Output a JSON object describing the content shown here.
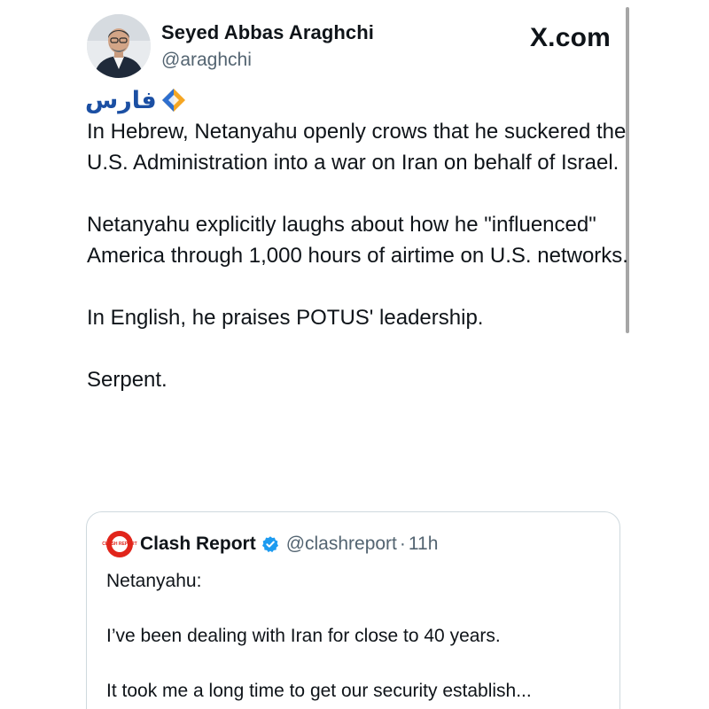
{
  "header": {
    "author_name": "Seyed Abbas Araghchi",
    "author_handle": "@araghchi",
    "brand": "X.com",
    "avatar_icon": "profile-photo"
  },
  "watermark": {
    "text": "فارس",
    "logo_icon": "fars-diamond-logo",
    "colors": {
      "text": "#1b4fa3",
      "diamond_primary": "#f5a623",
      "diamond_secondary": "#2e6fd0"
    }
  },
  "tweet": {
    "paragraphs": [
      "In Hebrew, Netanyahu openly crows that he suckered the U.S. Administration into a war on Iran on behalf of Israel.",
      "Netanyahu explicitly laughs about how he \"influenced\" America through 1,000 hours of airtime on U.S. networks.",
      "In English, he praises POTUS' leadership.",
      "Serpent."
    ]
  },
  "quote": {
    "name": "Clash Report",
    "handle": "@clashreport",
    "separator": "·",
    "time": "11h",
    "verified_icon": "verified-badge-icon",
    "avatar_text": "CLASH REPORT",
    "colors": {
      "avatar": "#e1251b",
      "verified": "#1d9bf0"
    },
    "paragraphs": [
      "Netanyahu:",
      "I’ve been dealing with Iran for close to 40 years.",
      "It took me a long time to get our security establish..."
    ]
  }
}
